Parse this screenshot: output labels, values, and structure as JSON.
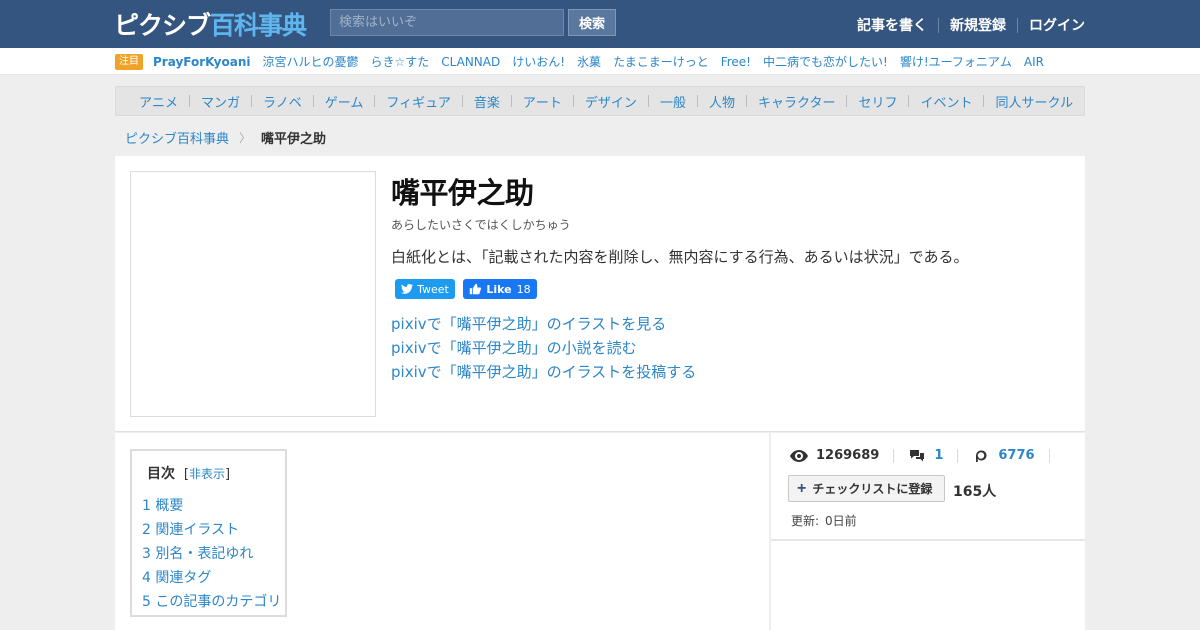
{
  "header": {
    "logo_kana": "ピクシブ",
    "logo_kanji": "百科事典",
    "search_placeholder": "検索はいいぞ",
    "search_button": "検索",
    "links": [
      "記事を書く",
      "新規登録",
      "ログイン"
    ]
  },
  "featured": {
    "badge": "注目",
    "items": [
      "PrayForKyoani",
      "涼宮ハルヒの憂鬱",
      "らき☆すた",
      "CLANNAD",
      "けいおん!",
      "氷菓",
      "たまこまーけっと",
      "Free!",
      "中二病でも恋がしたい!",
      "響け!ユーフォニアム",
      "AIR"
    ]
  },
  "categories": [
    "アニメ",
    "マンガ",
    "ラノベ",
    "ゲーム",
    "フィギュア",
    "音楽",
    "アート",
    "デザイン",
    "一般",
    "人物",
    "キャラクター",
    "セリフ",
    "イベント",
    "同人サークル"
  ],
  "breadcrumb": {
    "home": "ピクシブ百科事典",
    "current": "嘴平伊之助"
  },
  "article": {
    "title": "嘴平伊之助",
    "reading": "あらしたいさくではくしかちゅう",
    "summary": "白紙化とは、「記載された内容を削除し、無内容にする行為、あるいは状況」である。",
    "tweet_label": "Tweet",
    "like_label": "Like",
    "like_count": "18",
    "pixiv_links": [
      "pixivで「嘴平伊之助」のイラストを見る",
      "pixivで「嘴平伊之助」の小説を読む",
      "pixivで「嘴平伊之助」のイラストを投稿する"
    ]
  },
  "toc": {
    "title": "目次",
    "hide_open": "[",
    "hide_label": "非表示",
    "hide_close": "]",
    "items": [
      "1 概要",
      "2 関連イラスト",
      "3 別名・表記ゆれ",
      "4 関連タグ",
      "5 この記事のカテゴリ"
    ]
  },
  "sidebar": {
    "views": "1269689",
    "comments": "1",
    "pixiv_count": "6776",
    "checklist_button": "チェックリストに登録",
    "checklist_count": "165人",
    "updated_label": "更新:",
    "updated_value": "0日前"
  },
  "colors": {
    "header_bg": "#34557f",
    "link": "#2c86c8",
    "badge": "#f0a32b",
    "twitter": "#1d9bf0",
    "facebook": "#1877f2"
  }
}
